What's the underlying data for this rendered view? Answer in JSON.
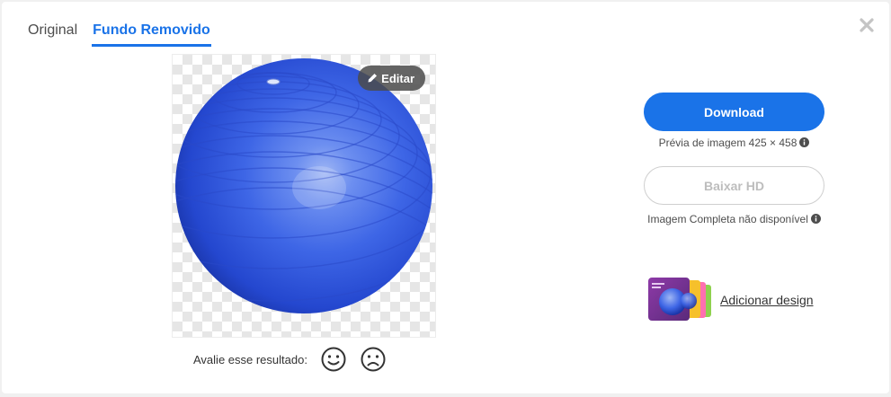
{
  "tabs": [
    {
      "label": "Original",
      "active": false
    },
    {
      "label": "Fundo Removido",
      "active": true
    }
  ],
  "image": {
    "edit_label": "Editar",
    "subject": "blue-exercise-ball"
  },
  "rating": {
    "label": "Avalie esse resultado:"
  },
  "actions": {
    "download_label": "Download",
    "preview_text": "Prévia de imagem 425 × 458",
    "hd_label": "Baixar HD",
    "hd_note": "Imagem Completa não disponível",
    "add_design_label": "Adicionar design"
  },
  "colors": {
    "accent": "#1a73e8",
    "ball": "#3a64e8"
  },
  "icons": [
    "close-icon",
    "pencil-icon",
    "smile-icon",
    "frown-icon",
    "info-icon"
  ]
}
